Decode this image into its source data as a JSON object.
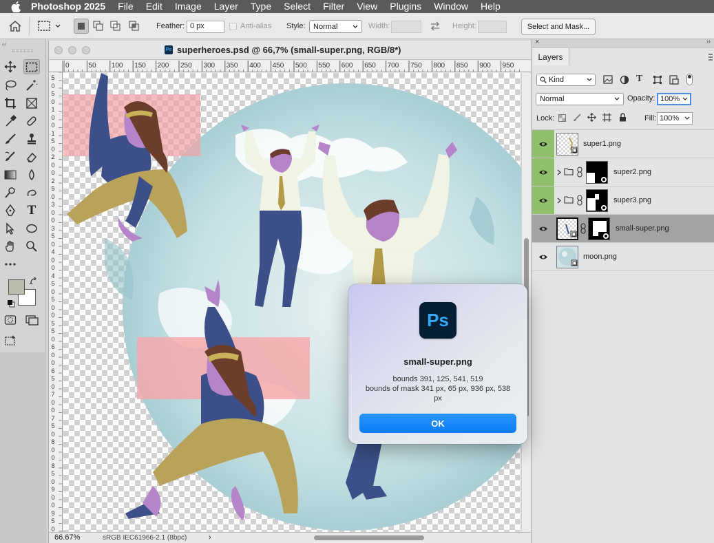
{
  "menubar": {
    "app": "Photoshop 2025",
    "items": [
      "File",
      "Edit",
      "Image",
      "Layer",
      "Type",
      "Select",
      "Filter",
      "View",
      "Plugins",
      "Window",
      "Help"
    ]
  },
  "options": {
    "feather_label": "Feather:",
    "feather_value": "0 px",
    "antialias_label": "Anti-alias",
    "style_label": "Style:",
    "style_value": "Normal",
    "width_label": "Width:",
    "height_label": "Height:",
    "select_mask_label": "Select and Mask..."
  },
  "document": {
    "title": "superheroes.psd @ 66,7% (small-super.png, RGB/8*)",
    "ps_badge": "Ps",
    "ruler_h": [
      "0",
      "50",
      "100",
      "150",
      "200",
      "250",
      "300",
      "350",
      "400",
      "450",
      "500",
      "550",
      "600",
      "650",
      "700",
      "750",
      "800",
      "850",
      "900",
      "950"
    ],
    "ruler_v": [
      "5",
      "0",
      "5",
      "0",
      "1",
      "0",
      "0",
      "1",
      "5",
      "0",
      "2",
      "0",
      "0",
      "2",
      "5",
      "0",
      "3",
      "0",
      "0",
      "3",
      "5",
      "0",
      "4",
      "0",
      "0",
      "4",
      "5",
      "0",
      "5",
      "0",
      "0",
      "5",
      "5",
      "0",
      "6",
      "0",
      "0",
      "6",
      "5",
      "0",
      "7",
      "0",
      "0",
      "7",
      "5",
      "0",
      "8",
      "0",
      "0",
      "8",
      "5",
      "0",
      "9",
      "0",
      "0",
      "9",
      "5",
      "0"
    ],
    "zoom": "66.67%",
    "profile": "sRGB IEC61966-2.1 (8bpc)",
    "chevron": "›"
  },
  "layers_panel": {
    "tab": "Layers",
    "kind": "Kind",
    "blend": "Normal",
    "opacity_label": "Opacity:",
    "opacity": "100%",
    "lock_label": "Lock:",
    "fill_label": "Fill:",
    "fill": "100%",
    "layers": [
      {
        "name": "super1.png"
      },
      {
        "name": "super2.png"
      },
      {
        "name": "super3.png"
      },
      {
        "name": "small-super.png"
      },
      {
        "name": "moon.png"
      }
    ]
  },
  "dialog": {
    "icon_text": "Ps",
    "title": "small-super.png",
    "message": "bounds 391, 125, 541, 519\nbounds of mask 341 px, 65 px, 936 px, 538 px",
    "ok_label": "OK"
  },
  "colors": {
    "foreground": "#b9bdac",
    "background": "#ffffff",
    "visible_highlight": "#8fc06b",
    "accent": "#0a7cf5"
  }
}
